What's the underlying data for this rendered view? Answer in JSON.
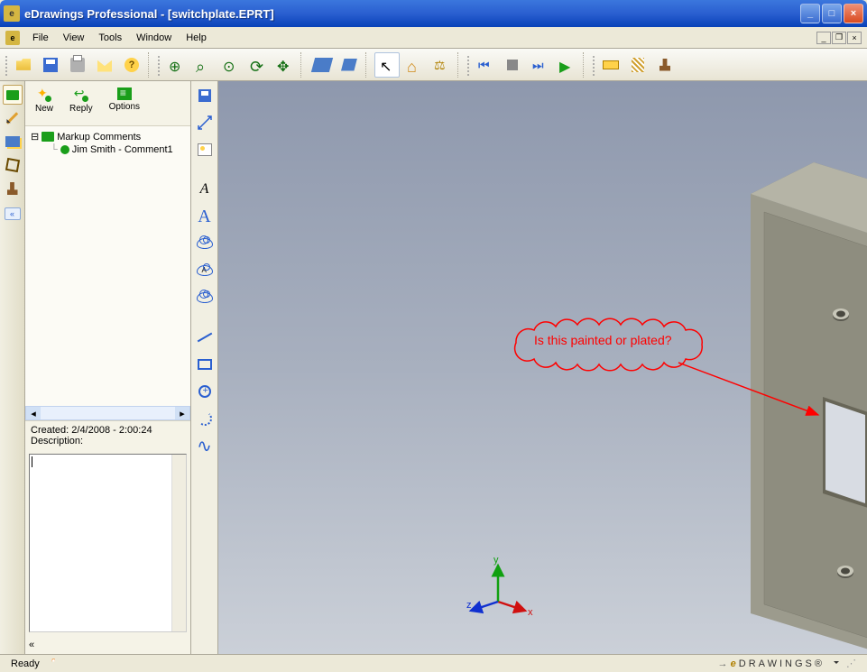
{
  "window": {
    "title": "eDrawings Professional - [switchplate.EPRT]"
  },
  "menu": {
    "file": "File",
    "view": "View",
    "tools": "Tools",
    "window": "Window",
    "help": "Help"
  },
  "markup_panel": {
    "new": "New",
    "reply": "Reply",
    "options": "Options",
    "tree_root": "Markup Comments",
    "tree_item1": "Jim Smith - Comment1",
    "created_label": "Created:",
    "created_value": "2/4/2008 - 2:00:24",
    "description_label": "Description:",
    "description_value": ""
  },
  "callout": {
    "text": "Is this painted or plated?"
  },
  "triad": {
    "x": "x",
    "y": "y",
    "z": "z"
  },
  "status": {
    "ready": "Ready",
    "brand": "DRAWINGS®"
  }
}
